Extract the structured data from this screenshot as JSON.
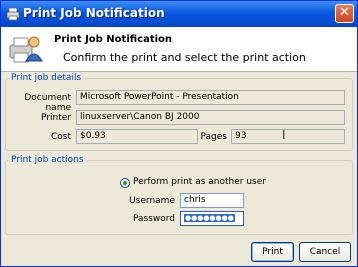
{
  "window": {
    "title": "Print Job Notification",
    "close_glyph": "✕"
  },
  "header": {
    "title": "Print Job Notification",
    "subtitle": "Confirm the print and select the print action"
  },
  "details": {
    "legend": "Print job details",
    "document_label": "Document name",
    "document_value": "Microsoft PowerPoint - Presentation",
    "printer_label": "Printer",
    "printer_value": "linuxserver\\Canon BJ 2000",
    "cost_label": "Cost",
    "cost_value": "$0.93",
    "pages_label": "Pages",
    "pages_value": "93"
  },
  "actions": {
    "legend": "Print job actions",
    "radio_label": "Perform print as another user",
    "username_label": "Username",
    "username_value": "chris",
    "password_label": "Password",
    "password_value": "●●●●●●●●"
  },
  "buttons": {
    "print": "Print",
    "cancel": "Cancel"
  },
  "colors": {
    "accent": "#0046d5",
    "title_bar": "#0a58e0"
  }
}
